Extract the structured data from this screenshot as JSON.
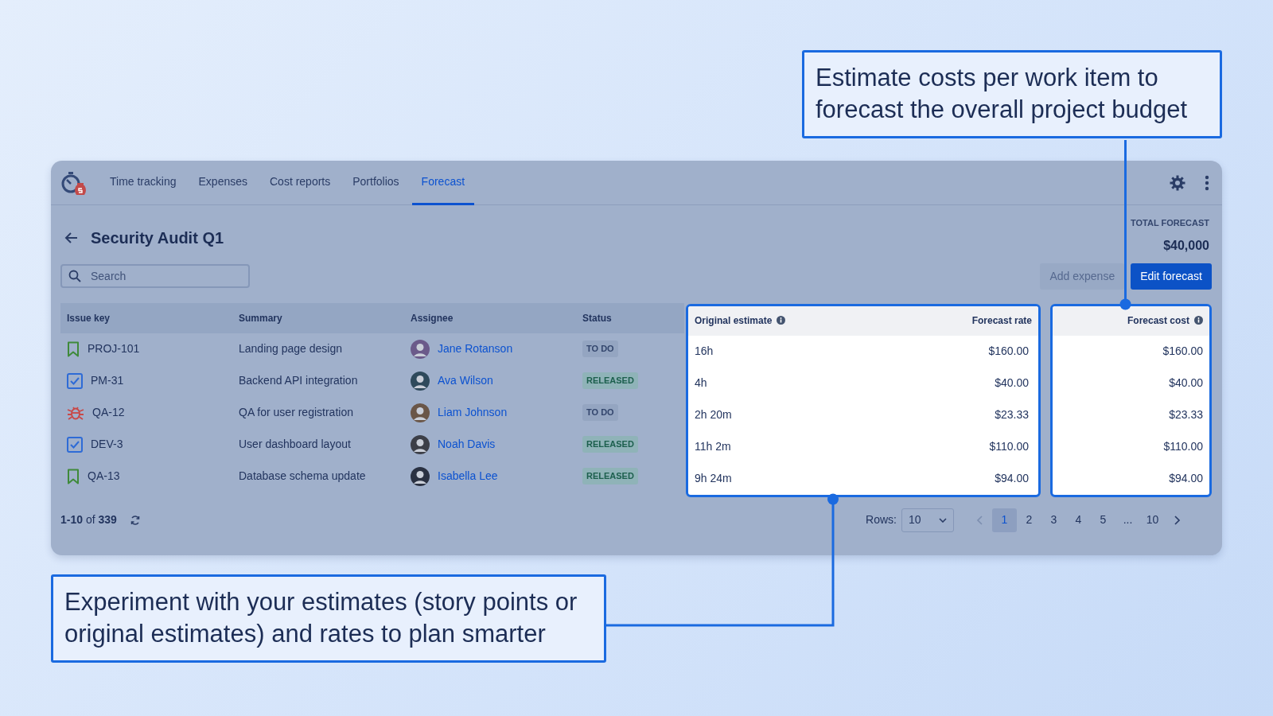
{
  "callouts": [
    {
      "text": "Estimate costs per work item to forecast the overall project budget"
    },
    {
      "text": "Experiment with your estimates (story points or original estimates) and rates to plan smarter"
    }
  ],
  "app": {
    "nav_tabs": [
      {
        "label": "Time tracking",
        "selected": false
      },
      {
        "label": "Expenses",
        "selected": false
      },
      {
        "label": "Cost reports",
        "selected": false
      },
      {
        "label": "Portfolios",
        "selected": false
      },
      {
        "label": "Forecast",
        "selected": true
      }
    ],
    "title": "Security Audit Q1",
    "total_forecast": {
      "label": "TOTAL FORECAST",
      "value": "$40,000"
    },
    "search": {
      "placeholder": "Search"
    },
    "buttons": [
      {
        "label": "Add expense",
        "disabled": true
      },
      {
        "label": "Edit forecast",
        "disabled": false
      }
    ],
    "table": {
      "columns": [
        {
          "label": "Issue key",
          "info": false
        },
        {
          "label": "Summary",
          "info": false
        },
        {
          "label": "Assignee",
          "info": false
        },
        {
          "label": "Status",
          "info": false
        },
        {
          "label": "Original estimate",
          "info": true
        },
        {
          "label": "Forecast rate",
          "info": false
        },
        {
          "label": "Forecast cost",
          "info": true
        }
      ],
      "rows": [
        {
          "kind": "story",
          "issue_key": "PROJ-101",
          "summary": "Landing page design",
          "assignee": "Jane Rotanson",
          "status": {
            "label": "TO DO",
            "kind": "todo"
          },
          "original_estimate": "16h",
          "forecast_rate": "$160.00",
          "forecast_cost": "$160.00"
        },
        {
          "kind": "task",
          "issue_key": "PM-31",
          "summary": "Backend API integration",
          "assignee": "Ava Wilson",
          "status": {
            "label": "RELEASED",
            "kind": "released"
          },
          "original_estimate": "4h",
          "forecast_rate": "$40.00",
          "forecast_cost": "$40.00"
        },
        {
          "kind": "bug",
          "issue_key": "QA-12",
          "summary": "QA for user registration",
          "assignee": "Liam Johnson",
          "status": {
            "label": "TO DO",
            "kind": "todo"
          },
          "original_estimate": "2h 20m",
          "forecast_rate": "$23.33",
          "forecast_cost": "$23.33"
        },
        {
          "kind": "task",
          "issue_key": "DEV-3",
          "summary": "User dashboard layout",
          "assignee": "Noah Davis",
          "status": {
            "label": "RELEASED",
            "kind": "released"
          },
          "original_estimate": "11h 2m",
          "forecast_rate": "$110.00",
          "forecast_cost": "$110.00"
        },
        {
          "kind": "story",
          "issue_key": "QA-13",
          "summary": "Database schema update",
          "assignee": "Isabella Lee",
          "status": {
            "label": "RELEASED",
            "kind": "released"
          },
          "original_estimate": "9h 24m",
          "forecast_rate": "$94.00",
          "forecast_cost": "$94.00"
        }
      ]
    },
    "footer": {
      "range": "**1-10** of **339**"
    },
    "pagination": {
      "rows_label": "Rows:",
      "rows_value": "10",
      "previous": {
        "disabled": true
      },
      "next": {
        "disabled": false
      },
      "pages": [
        {
          "label": "1",
          "selected": true
        },
        {
          "label": "2",
          "selected": false
        },
        {
          "label": "3",
          "selected": false
        },
        {
          "label": "4",
          "selected": false
        },
        {
          "label": "5",
          "selected": false
        },
        {
          "label": "...",
          "selected": false
        },
        {
          "label": "10",
          "selected": false
        }
      ]
    }
  }
}
